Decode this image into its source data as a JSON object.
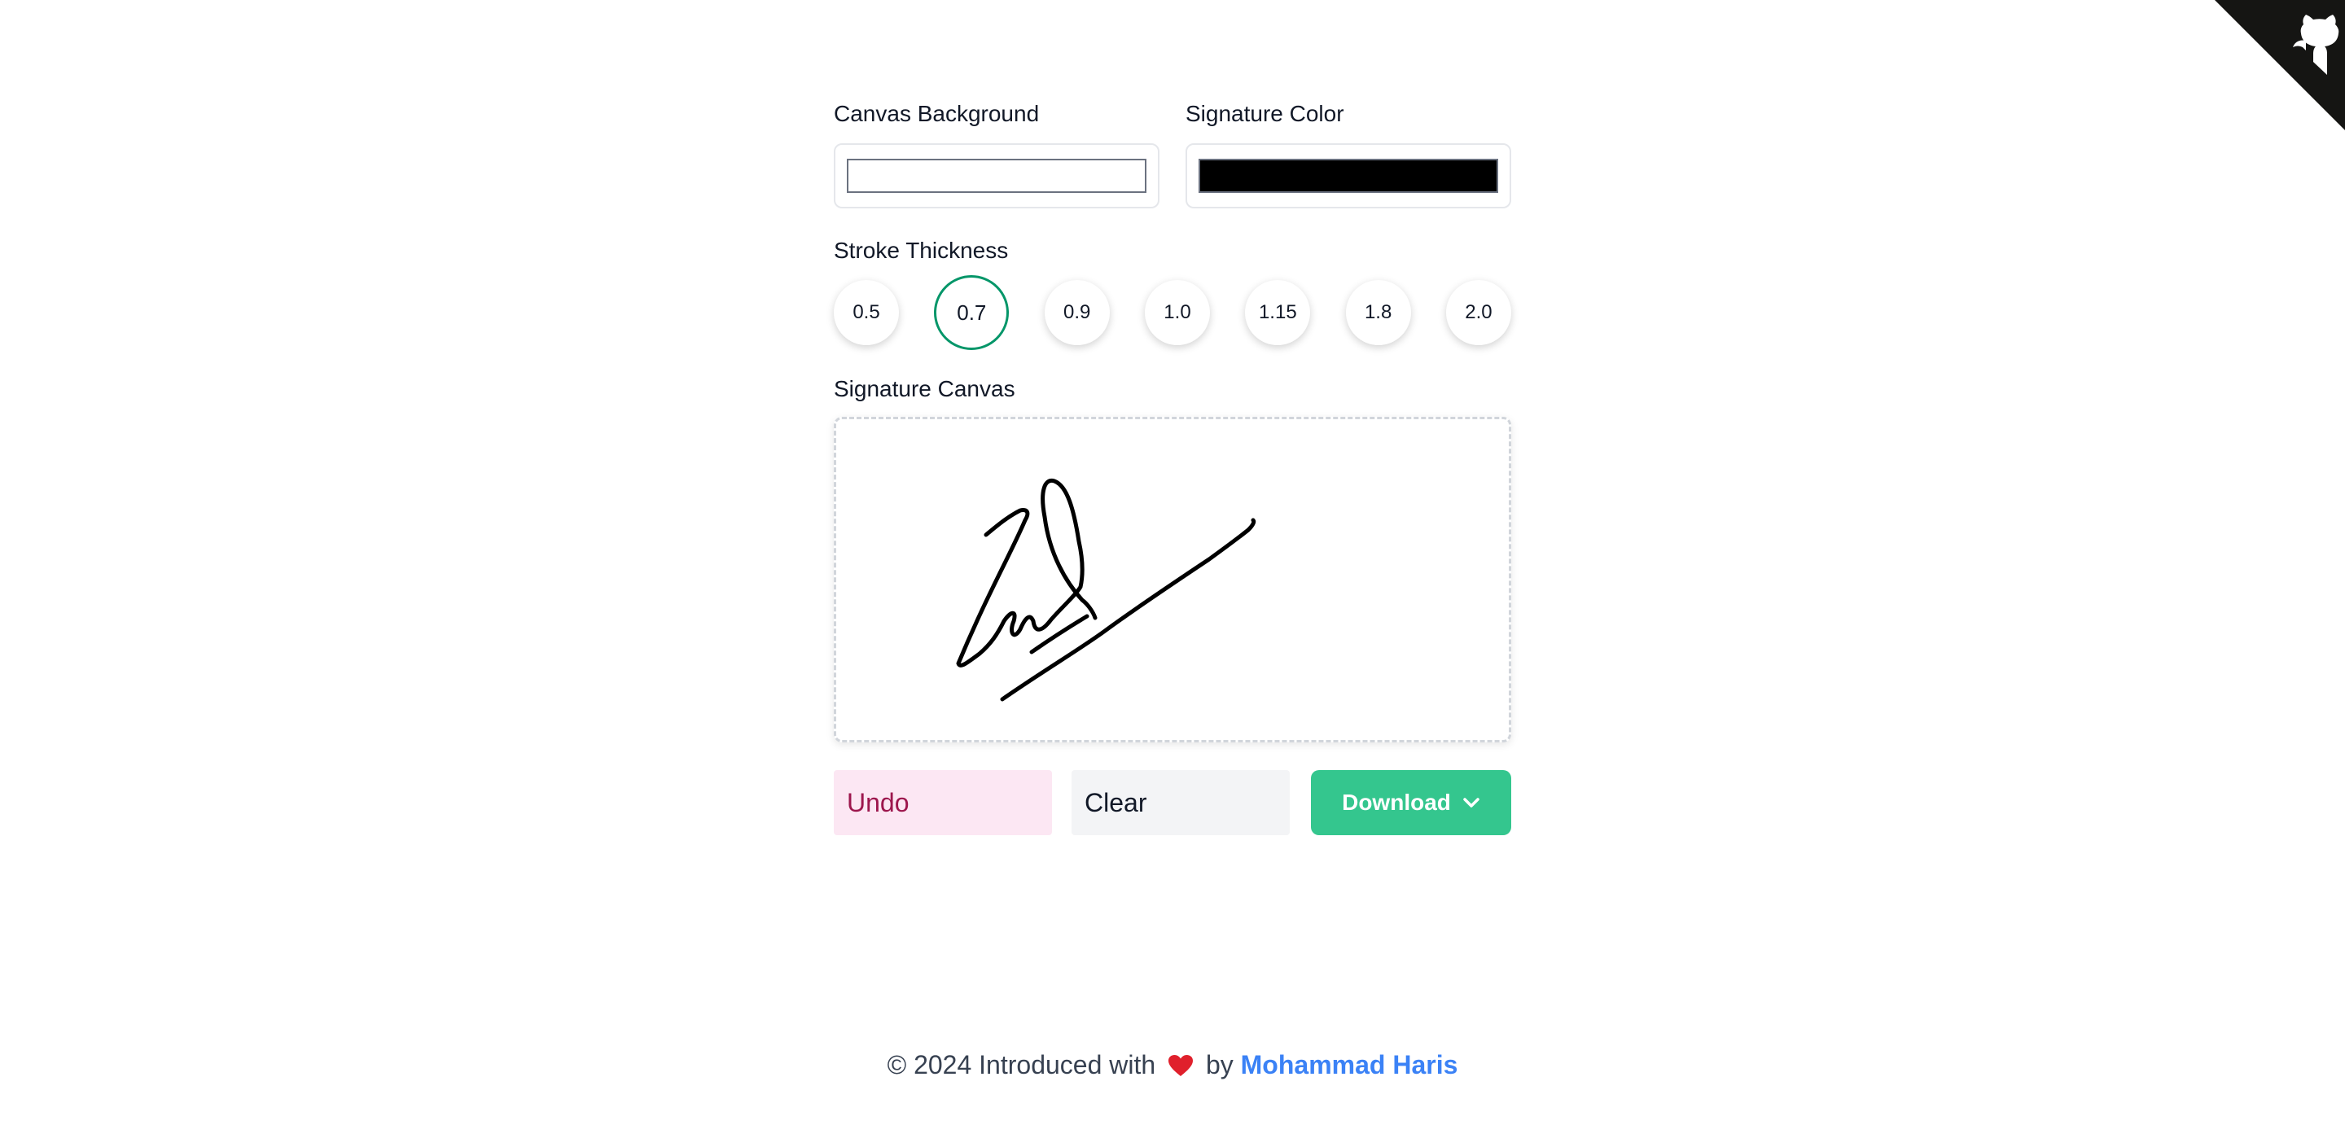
{
  "controls": {
    "canvas_background_label": "Canvas Background",
    "canvas_background_color": "#ffffff",
    "signature_color_label": "Signature Color",
    "signature_color": "#000000"
  },
  "stroke": {
    "label": "Stroke Thickness",
    "options": [
      "0.5",
      "0.7",
      "0.9",
      "1.0",
      "1.15",
      "1.8",
      "2.0"
    ],
    "selected": "0.7",
    "accent_color": "#059669"
  },
  "canvas": {
    "label": "Signature Canvas"
  },
  "actions": {
    "undo_label": "Undo",
    "clear_label": "Clear",
    "download_label": "Download",
    "download_color": "#34c68e"
  },
  "footer": {
    "copyright": "© 2024 Introduced with",
    "by": "by",
    "author": "Mohammad Haris",
    "author_color": "#3b82f6"
  },
  "icons": [
    "github-octocat-icon",
    "heart-icon",
    "chevron-down-icon"
  ]
}
